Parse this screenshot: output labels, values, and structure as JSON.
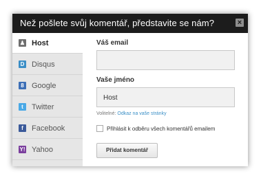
{
  "dialog": {
    "title": "Než pošlete svůj komentář, představite se nám?",
    "close_glyph": "×"
  },
  "sidebar": {
    "items": [
      {
        "label": "Host",
        "icon": "user-icon",
        "icon_glyph": "♟",
        "icon_color": "#6e6e6e",
        "active": true
      },
      {
        "label": "Disqus",
        "icon": "disqus-icon",
        "icon_glyph": "D",
        "icon_color": "#3b8ec6",
        "active": false
      },
      {
        "label": "Google",
        "icon": "google-icon",
        "icon_glyph": "8",
        "icon_color": "#3d6fb6",
        "active": false
      },
      {
        "label": "Twitter",
        "icon": "twitter-icon",
        "icon_glyph": "t",
        "icon_color": "#4aa9e6",
        "active": false
      },
      {
        "label": "Facebook",
        "icon": "facebook-icon",
        "icon_glyph": "f",
        "icon_color": "#3b5a9a",
        "active": false
      },
      {
        "label": "Yahoo",
        "icon": "yahoo-icon",
        "icon_glyph": "Y!",
        "icon_color": "#7a3e9d",
        "active": false
      }
    ]
  },
  "form": {
    "email_label": "Váš email",
    "email_value": "",
    "name_label": "Vaše jméno",
    "name_value": "Host",
    "optional_prefix": "Volitelné:",
    "optional_link": "Odkaz na vaše stránky",
    "subscribe_label": "Přihlásit k odběru všech komentářů emailem",
    "submit_label": "Přidat komentář"
  }
}
